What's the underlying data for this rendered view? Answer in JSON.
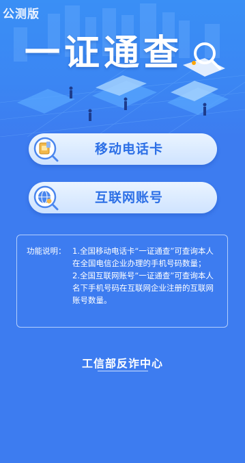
{
  "beta_label": "公测版",
  "brand_title": "一证通查",
  "buttons": [
    {
      "label": "移动电话卡",
      "icon": "sim-card-search-icon"
    },
    {
      "label": "互联网账号",
      "icon": "globe-search-icon"
    }
  ],
  "notice": {
    "title": "功能说明：",
    "items": [
      "1.全国移动电话卡“一证通查”可查询本人在全国电信企业办理的手机号码数量；",
      "2.全国互联网账号“一证通查”可查询本人名下手机号码在互联网企业注册的互联网账号数量。"
    ]
  },
  "footer": "工信部反诈中心",
  "colors": {
    "background": "#3d7cf0",
    "button_text": "#2c6fe6",
    "button_bg": "#dbeaff"
  }
}
